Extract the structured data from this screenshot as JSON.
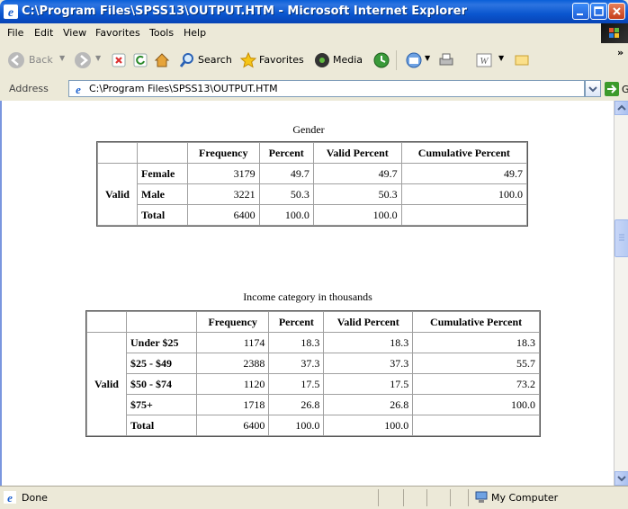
{
  "window": {
    "title": "C:\\Program Files\\SPSS13\\OUTPUT.HTM - Microsoft Internet Explorer"
  },
  "menu": [
    "File",
    "Edit",
    "View",
    "Favorites",
    "Tools",
    "Help"
  ],
  "toolbar": {
    "back_label": "Back",
    "search_label": "Search",
    "favorites_label": "Favorites",
    "media_label": "Media"
  },
  "address": {
    "label": "Address",
    "url": "C:\\Program Files\\SPSS13\\OUTPUT.HTM",
    "go_label": "Go"
  },
  "tables": {
    "gender": {
      "caption": "Gender",
      "headers": [
        "Frequency",
        "Percent",
        "Valid Percent",
        "Cumulative Percent"
      ],
      "group_label": "Valid",
      "rows": [
        {
          "label": "Female",
          "frequency": "3179",
          "percent": "49.7",
          "valid_percent": "49.7",
          "cumulative_percent": "49.7"
        },
        {
          "label": "Male",
          "frequency": "3221",
          "percent": "50.3",
          "valid_percent": "50.3",
          "cumulative_percent": "100.0"
        },
        {
          "label": "Total",
          "frequency": "6400",
          "percent": "100.0",
          "valid_percent": "100.0",
          "cumulative_percent": ""
        }
      ]
    },
    "income": {
      "caption": "Income category in thousands",
      "headers": [
        "Frequency",
        "Percent",
        "Valid Percent",
        "Cumulative Percent"
      ],
      "group_label": "Valid",
      "rows": [
        {
          "label": "Under $25",
          "frequency": "1174",
          "percent": "18.3",
          "valid_percent": "18.3",
          "cumulative_percent": "18.3"
        },
        {
          "label": "$25 - $49",
          "frequency": "2388",
          "percent": "37.3",
          "valid_percent": "37.3",
          "cumulative_percent": "55.7"
        },
        {
          "label": "$50 - $74",
          "frequency": "1120",
          "percent": "17.5",
          "valid_percent": "17.5",
          "cumulative_percent": "73.2"
        },
        {
          "label": "$75+",
          "frequency": "1718",
          "percent": "26.8",
          "valid_percent": "26.8",
          "cumulative_percent": "100.0"
        },
        {
          "label": "Total",
          "frequency": "6400",
          "percent": "100.0",
          "valid_percent": "100.0",
          "cumulative_percent": ""
        }
      ]
    }
  },
  "status": {
    "text": "Done",
    "zone": "My Computer"
  },
  "icons": {
    "window": "ie-logo-icon",
    "minimize": "minimize-icon",
    "maximize": "maximize-icon",
    "close": "close-icon"
  },
  "colors": {
    "titlebar": "#0a56cf",
    "close_button": "#c53d1a",
    "go_button": "#3c9a2b"
  }
}
